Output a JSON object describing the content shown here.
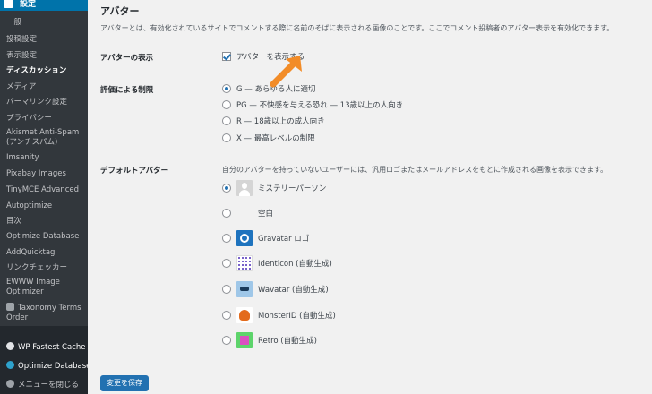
{
  "sidebar": {
    "section_title": "設定",
    "items": [
      {
        "label": "一般"
      },
      {
        "label": "投稿設定"
      },
      {
        "label": "表示設定"
      },
      {
        "label": "ディスカッション",
        "current": true
      },
      {
        "label": "メディア"
      },
      {
        "label": "パーマリンク設定"
      },
      {
        "label": "プライバシー"
      },
      {
        "label": "Akismet Anti-Spam (アンチスパム)"
      },
      {
        "label": "Imsanity"
      },
      {
        "label": "Pixabay Images"
      },
      {
        "label": "TinyMCE Advanced"
      },
      {
        "label": "Autoptimize"
      },
      {
        "label": "目次"
      },
      {
        "label": "Optimize Database"
      },
      {
        "label": "AddQuicktag"
      },
      {
        "label": "リンクチェッカー"
      },
      {
        "label": "EWWW Image Optimizer"
      },
      {
        "label": "Taxonomy Terms Order"
      }
    ],
    "plugins": [
      {
        "label": "WP Fastest Cache",
        "icon": "wp-fastest-cache-icon"
      },
      {
        "label": "Optimize Database",
        "icon": "optimize-database-icon"
      }
    ],
    "collapse_label": "メニューを閉じる"
  },
  "main": {
    "heading": "アバター",
    "description": "アバターとは、有効化されているサイトでコメントする際に名前のそばに表示される画像のことです。ここでコメント投稿者のアバター表示を有効化できます。",
    "avatar_display": {
      "label": "アバターの表示",
      "checkbox_label": "アバターを表示する",
      "checked": true
    },
    "rating": {
      "label": "評価による制限",
      "options": [
        {
          "label": "G — あらゆる人に適切",
          "checked": true
        },
        {
          "label": "PG — 不快感を与える恐れ — 13歳以上の人向き",
          "checked": false
        },
        {
          "label": "R — 18歳以上の成人向き",
          "checked": false
        },
        {
          "label": "X — 最高レベルの制限",
          "checked": false
        }
      ]
    },
    "default_avatar": {
      "label": "デフォルトアバター",
      "description": "自分のアバターを持っていないユーザーには、汎用ロゴまたはメールアドレスをもとに作成される画像を表示できます。",
      "options": [
        {
          "label": "ミステリーパーソン",
          "icon": "mystery-person-avatar",
          "checked": true
        },
        {
          "label": "空白",
          "icon": "blank-avatar",
          "checked": false
        },
        {
          "label": "Gravatar ロゴ",
          "icon": "gravatar-logo-avatar",
          "checked": false
        },
        {
          "label": "Identicon (自動生成)",
          "icon": "identicon-avatar",
          "checked": false
        },
        {
          "label": "Wavatar (自動生成)",
          "icon": "wavatar-avatar",
          "checked": false
        },
        {
          "label": "MonsterID (自動生成)",
          "icon": "monsterid-avatar",
          "checked": false
        },
        {
          "label": "Retro (自動生成)",
          "icon": "retro-avatar",
          "checked": false
        }
      ]
    },
    "save_button": "変更を保存"
  },
  "colors": {
    "sidebar_bg": "#23282d",
    "sidebar_active": "#0073aa",
    "accent": "#2271b1",
    "annotation_arrow": "#f28c28"
  }
}
